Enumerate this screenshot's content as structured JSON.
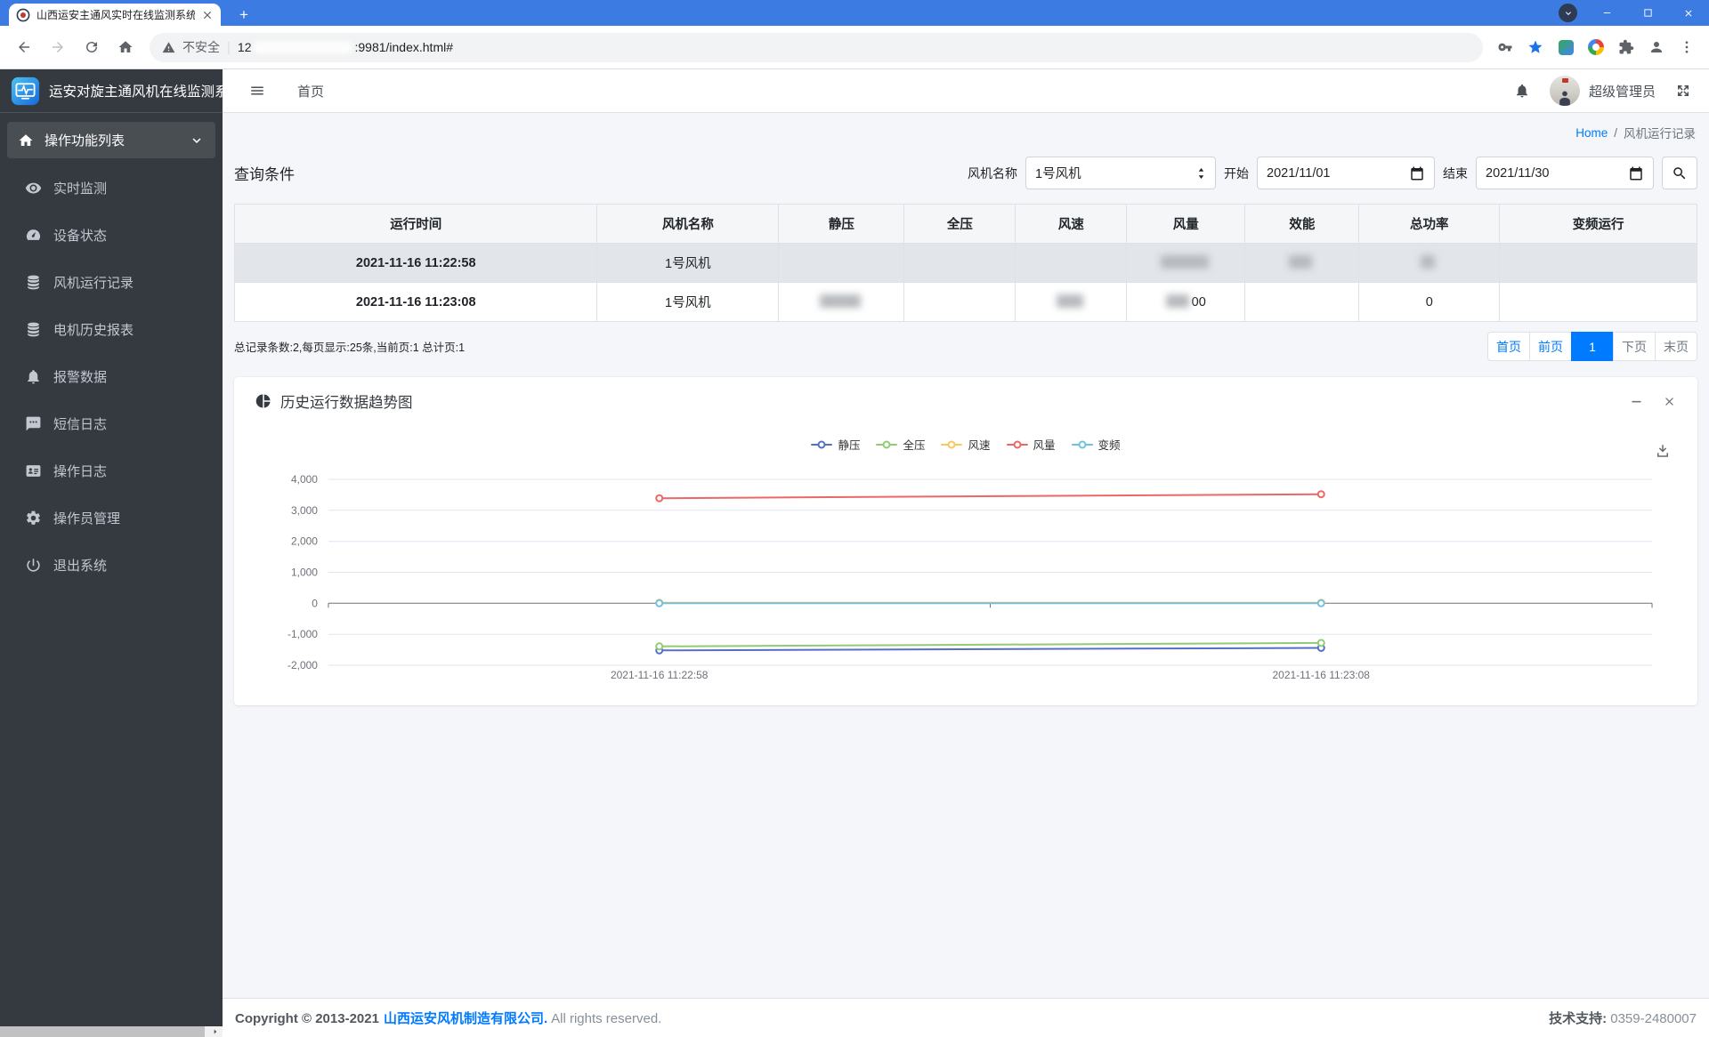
{
  "browser": {
    "tab_title": "山西运安主通风实时在线监测系统",
    "security_label": "不安全",
    "url_host": "12",
    "url_rest": ":9981/index.html#"
  },
  "sidebar": {
    "brand": "运安对旋主通风机在线监测系统",
    "menu_header": "操作功能列表",
    "items": [
      {
        "label": "实时监测",
        "icon": "eye"
      },
      {
        "label": "设备状态",
        "icon": "gauge"
      },
      {
        "label": "风机运行记录",
        "icon": "database"
      },
      {
        "label": "电机历史报表",
        "icon": "database"
      },
      {
        "label": "报警数据",
        "icon": "bell"
      },
      {
        "label": "短信日志",
        "icon": "comment"
      },
      {
        "label": "操作日志",
        "icon": "id-card"
      },
      {
        "label": "操作员管理",
        "icon": "gear"
      },
      {
        "label": "退出系统",
        "icon": "power"
      }
    ]
  },
  "header": {
    "home_link": "首页",
    "user_name": "超级管理员"
  },
  "breadcrumb": {
    "home": "Home",
    "separator": "/",
    "current": "风机运行记录"
  },
  "query": {
    "title": "查询条件",
    "fan_label": "风机名称",
    "fan_value": "1号风机",
    "start_label": "开始",
    "start_value": "2021/11/01",
    "end_label": "结束",
    "end_value": "2021/11/30"
  },
  "table": {
    "columns": [
      "运行时间",
      "风机名称",
      "静压",
      "全压",
      "风速",
      "风量",
      "效能",
      "总功率",
      "变频运行"
    ],
    "rows": [
      {
        "selected": true,
        "cells": [
          {
            "text": "2021-11-16 11:22:58"
          },
          {
            "text": "1号风机"
          },
          {
            "text": ""
          },
          {
            "text": ""
          },
          {
            "text": ""
          },
          {
            "text": "",
            "redacted": true,
            "redact_width": 54
          },
          {
            "text": "",
            "redacted": true,
            "redact_width": 26
          },
          {
            "text": "",
            "redacted": true,
            "redact_width": 16
          },
          {
            "text": ""
          }
        ]
      },
      {
        "selected": false,
        "cells": [
          {
            "text": "2021-11-16 11:23:08"
          },
          {
            "text": "1号风机"
          },
          {
            "text": "",
            "redacted": true,
            "redact_width": 46
          },
          {
            "text": ""
          },
          {
            "text": "",
            "redacted": true,
            "redact_width": 30
          },
          {
            "text": "00",
            "redacted": true,
            "redact_width": 26
          },
          {
            "text": ""
          },
          {
            "text": "0"
          },
          {
            "text": ""
          }
        ]
      }
    ]
  },
  "pagination": {
    "summary": "总记录条数:2,每页显示:25条,当前页:1 总计页:1",
    "buttons": [
      {
        "label": "首页",
        "state": "link"
      },
      {
        "label": "前页",
        "state": "link"
      },
      {
        "label": "1",
        "state": "active"
      },
      {
        "label": "下页",
        "state": "muted"
      },
      {
        "label": "末页",
        "state": "muted"
      }
    ]
  },
  "chart": {
    "panel_title": "历史运行数据趋势图",
    "chart_data": {
      "type": "line",
      "x": [
        "2021-11-16 11:22:58",
        "2021-11-16 11:23:08"
      ],
      "series": [
        {
          "name": "静压",
          "color": "#5470c6",
          "values": [
            -1520,
            -1440
          ]
        },
        {
          "name": "全压",
          "color": "#91cc75",
          "values": [
            -1390,
            -1280
          ]
        },
        {
          "name": "风速",
          "color": "#fac858",
          "values": [
            17,
            17
          ]
        },
        {
          "name": "风量",
          "color": "#ee6666",
          "values": [
            3390,
            3520
          ]
        },
        {
          "name": "变频",
          "color": "#73c0de",
          "values": [
            0,
            0
          ]
        }
      ],
      "ylim": [
        -2000,
        4000
      ],
      "yticks": [
        4000,
        3000,
        2000,
        1000,
        0,
        -1000,
        -2000
      ],
      "ytick_labels": [
        "4,000",
        "3,000",
        "2,000",
        "1,000",
        "0",
        "-1,000",
        "-2,000"
      ],
      "legend_position": "top",
      "grid": true
    }
  },
  "footer": {
    "copyright_prefix": "Copyright © 2013-2021",
    "company": "山西运安风机制造有限公司.",
    "copyright_suffix": "All rights reserved.",
    "support_label": "技术支持:",
    "support_value": "0359-2480007"
  }
}
